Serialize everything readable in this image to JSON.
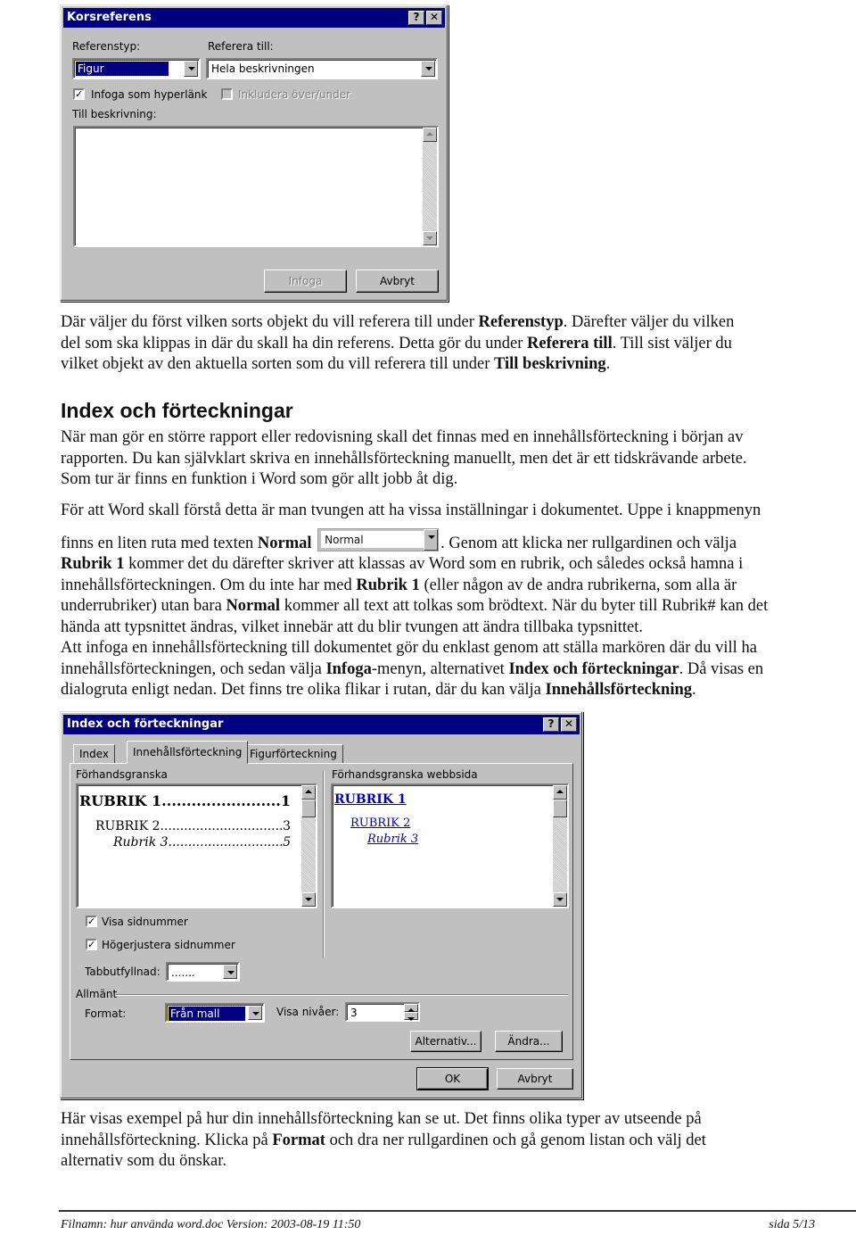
{
  "dialog1": {
    "title": "Korsreferens",
    "help_label": "?",
    "close_label": "✕",
    "reference_type_label": "Referenstyp:",
    "reference_type_value": "Figur",
    "refer_to_label": "Referera till:",
    "refer_to_value": "Hela beskrivningen",
    "insert_hyperlink_label": "Infoga som hyperlänk",
    "insert_hyperlink_checked": true,
    "include_above_below_label": "Inkludera över/under",
    "include_above_below_checked": false,
    "for_which_label": "Till beskrivning:",
    "insert_button": "Infoga",
    "cancel_button": "Avbryt"
  },
  "para1": {
    "l1a": "Där väljer du först vilken sorts objekt du vill referera till under ",
    "l1b": "Referenstyp",
    "l1c": ". Därefter väljer du vilken",
    "l2a": "del som ska klippas in där du skall ha din referens. Detta gör du under ",
    "l2b": "Referera till",
    "l2c": ". Till sist väljer du",
    "l3a": "vilket objekt av den aktuella sorten som du vill referera till under ",
    "l3b": "Till beskrivning",
    "l3c": "."
  },
  "heading": "Index och förteckningar",
  "para2": [
    "När man gör en större rapport eller redovisning skall det finnas med en innehållsförteckning i början av",
    "rapporten. Du kan självklart skriva en innehållsförteckning manuellt, men det är ett tidskrävande arbete.",
    "Som tur är finns en funktion i Word som gör allt jobb åt dig."
  ],
  "para3": {
    "l1": "För att Word skall förstå detta är man tvungen att ha vissa inställningar i dokumentet. Uppe i knappmenyn",
    "l2a": "finns en liten ruta med texten ",
    "l2b": "Normal",
    "style_box_value": "Normal",
    "l2c": ". Genom att klicka ner rullgardinen och välja",
    "l3a": "Rubrik 1",
    "l3b": " kommer det du därefter skriver att klassas av Word som en rubrik, och således också hamna i",
    "l4a": "innehållsförteckningen. Om du inte har med ",
    "l4b": "Rubrik 1",
    "l4c": " (eller någon av de andra rubrikerna, som alla är",
    "l5a": "underrubriker) utan bara ",
    "l5b": "Normal",
    "l5c": " kommer all text att tolkas som brödtext. När du byter till Rubrik# kan det",
    "l6": "hända att typsnittet ändras, vilket innebär att du blir tvungen att ändra tillbaka typsnittet.",
    "l7": "Att infoga en innehållsförteckning till dokumentet gör du enklast genom att ställa markören där du vill ha",
    "l8a": "innehållsförteckningen, och sedan välja ",
    "l8b": "Infoga",
    "l8c": "-menyn, alternativet ",
    "l8d": "Index och förteckningar",
    "l8e": ". Då visas en",
    "l9a": "dialogruta enligt nedan. Det finns tre olika flikar i rutan, där du kan välja ",
    "l9b": "Innehållsförteckning",
    "l9c": "."
  },
  "dialog2": {
    "title": "Index och förteckningar",
    "help_label": "?",
    "close_label": "✕",
    "tabs": [
      {
        "label": "Index",
        "active": false
      },
      {
        "label": "Innehållsförteckning",
        "active": true
      },
      {
        "label": "Figurförteckning",
        "active": false
      }
    ],
    "print_preview_label": "Förhandsgranska",
    "web_preview_label": "Förhandsgranska webbsida",
    "preview_entries": [
      {
        "text": "RUBRIK 1",
        "page": "1"
      },
      {
        "text": "RUBRIK 2",
        "page": "3"
      },
      {
        "text": "Rubrik 3",
        "page": "5"
      }
    ],
    "show_page_numbers_label": "Visa sidnummer",
    "show_page_numbers_checked": true,
    "right_align_label": "Högerjustera sidnummer",
    "right_align_checked": true,
    "tab_leader_label": "Tabbutfyllnad:",
    "tab_leader_value": ".......",
    "general_label": "Allmänt",
    "format_label": "Format:",
    "format_value": "Från mall",
    "show_levels_label": "Visa nivåer:",
    "show_levels_value": "3",
    "options_button": "Alternativ...",
    "modify_button": "Ändra...",
    "ok_button": "OK",
    "cancel_button": "Avbryt"
  },
  "para4": {
    "l1": "Här visas exempel på hur din innehållsförteckning kan se ut. Det finns olika typer av utseende på",
    "l2a": "innehållsförteckning. Klicka på ",
    "l2b": "Format",
    "l2c": " och dra ner rullgardinen och gå genom listan och välj det",
    "l3": "alternativ som du önskar."
  },
  "footer": {
    "left": "Filnamn: hur använda word.doc Version: 2003-08-19 11:50",
    "right": "sida 5/13"
  }
}
